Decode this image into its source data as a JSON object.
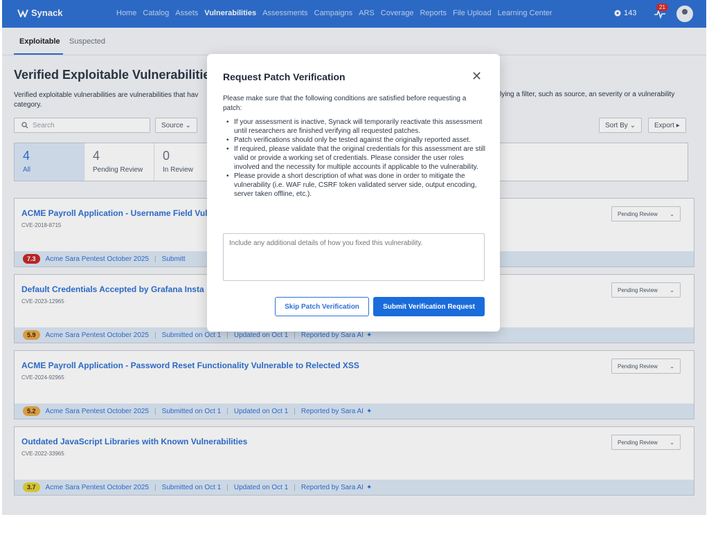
{
  "topbar": {
    "logo": "Synack",
    "nav": [
      "Home",
      "Catalog",
      "Assets",
      "Vulnerabilities",
      "Assessments",
      "Campaigns",
      "ARS",
      "Coverage",
      "Reports",
      "File Upload",
      "Learning Center"
    ],
    "active_nav": "Vulnerabilities",
    "points": "143",
    "notifications": "21"
  },
  "tabs": [
    "Exploitable",
    "Suspected"
  ],
  "page": {
    "title": "Verified Exploitable Vulnerabilities",
    "description": "Verified exploitable vulnerabilities are vulnerabilities that hav",
    "description2": "category.",
    "description_right": "lying a filter, such as source, an severity or a vulnerability",
    "search_placeholder": "Search",
    "source_filter": "Source",
    "sort_by": "Sort By",
    "export": "Export"
  },
  "stats": [
    {
      "num": "4",
      "label": "All"
    },
    {
      "num": "4",
      "label": "Pending Review"
    },
    {
      "num": "0",
      "label": "In Review"
    }
  ],
  "cards": [
    {
      "title": "ACME Payroll Application - Username Field Vul",
      "cve": "CVE-2018-8715",
      "status": "Pending Review",
      "score": "7.3",
      "score_color": "#c62828",
      "score_text": "#ffffff",
      "assessment": "Acme Sara Pentest October 2025",
      "submitted": "Submitt",
      "updated": "",
      "reported": ""
    },
    {
      "title": "Default Credentials Accepted by Grafana Insta",
      "cve": "CVE-2023-12965",
      "status": "Pending Review",
      "score": "5.9",
      "score_color": "#e8a84c",
      "score_text": "#3d2b00",
      "assessment": "Acme Sara Pentest October 2025",
      "submitted": "Submitted on Oct 1",
      "updated": "Updated on Oct 1",
      "reported": "Reported by Sara AI"
    },
    {
      "title": "ACME Payroll Application - Password Reset Functionality Vulnerable to Relected XSS",
      "cve": "CVE-2024-92965",
      "status": "Pending Review",
      "score": "5.2",
      "score_color": "#e8a84c",
      "score_text": "#3d2b00",
      "assessment": "Acme Sara Pentest October 2025",
      "submitted": "Submitted on Oct 1",
      "updated": "Updated on Oct 1",
      "reported": "Reported by Sara AI"
    },
    {
      "title": "Outdated JavaScript Libraries with Known Vulnerabilities",
      "cve": "CVE-2022-33965",
      "status": "Pending Review",
      "score": "3.7",
      "score_color": "#e5d13c",
      "score_text": "#3d3500",
      "assessment": "Acme Sara Pentest October 2025",
      "submitted": "Submitted on Oct 1",
      "updated": "Updated on Oct 1",
      "reported": "Reported by Sara AI"
    }
  ],
  "modal": {
    "title": "Request Patch Verification",
    "intro": "Please make sure that the following conditions are satisfied before requesting a patch:",
    "conditions": [
      "If your assessment is inactive, Synack will temporarily reactivate this assessment until researchers are finished verifying all requested patches.",
      "Patch verifications should only be tested against the originally reported asset.",
      "If required, please validate that the original credentials for this assessment are still valid or provide a working set of credentials. Please consider the user roles involved and the necessity for multiple accounts if applicable to the vulnerability.",
      "Please provide a short description of what was done in order to mitigate the vulnerability (i.e. WAF rule, CSRF token validated server side, output encoding, server taken offline, etc.)."
    ],
    "textarea_placeholder": "Include any additional details of how you fixed this vulnerability.",
    "skip_label": "Skip Patch Verification",
    "submit_label": "Submit Verification Request"
  }
}
